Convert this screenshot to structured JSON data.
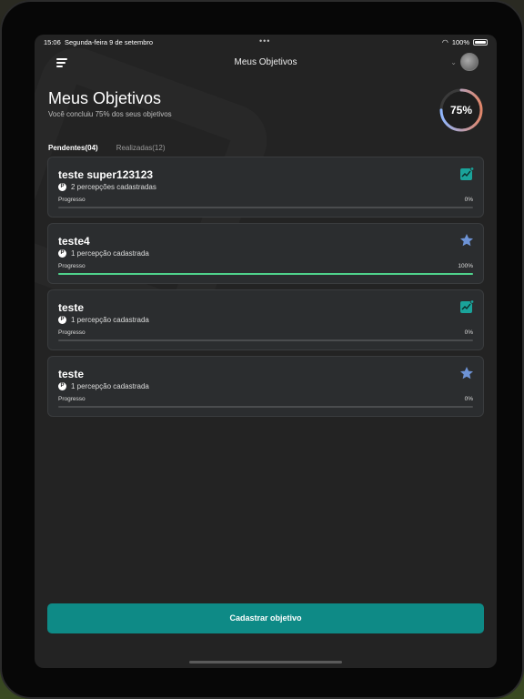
{
  "status_bar": {
    "time": "15:06",
    "date": "Segunda-feira 9 de setembro",
    "battery": "100%"
  },
  "header": {
    "title": "Meus Objetivos"
  },
  "summary": {
    "title": "Meus Objetivos",
    "subtitle": "Você concluiu 75% dos seus objetivos",
    "progress_label": "75%",
    "progress_fraction": 0.75,
    "ring_color": "#8fb7ff",
    "ring_color_end": "#e0866a"
  },
  "tabs": [
    {
      "label": "Pendentes(04)",
      "active": true
    },
    {
      "label": "Realizadas(12)",
      "active": false
    }
  ],
  "cards": [
    {
      "title": "teste super123123",
      "perceptions": "2 percepções cadastradas",
      "progress_label": "Progresso",
      "progress_value": "0%",
      "progress": 0,
      "icon": "chart-trend-icon"
    },
    {
      "title": "teste4",
      "perceptions": "1 percepção cadastrada",
      "progress_label": "Progresso",
      "progress_value": "100%",
      "progress": 1,
      "icon": "star-icon"
    },
    {
      "title": "teste",
      "perceptions": "1 percepção cadastrada",
      "progress_label": "Progresso",
      "progress_value": "0%",
      "progress": 0,
      "icon": "chart-trend-icon"
    },
    {
      "title": "teste",
      "perceptions": "1 percepção cadastrada",
      "progress_label": "Progresso",
      "progress_value": "0%",
      "progress": 0,
      "icon": "star-icon"
    }
  ],
  "perception_badge": "P",
  "cta": {
    "label": "Cadastrar objetivo"
  },
  "colors": {
    "accent": "#0e8a86",
    "progress_fill": "#4fd18b",
    "chart_icon": "#1aa39a",
    "star_icon": "#6d93d6"
  }
}
